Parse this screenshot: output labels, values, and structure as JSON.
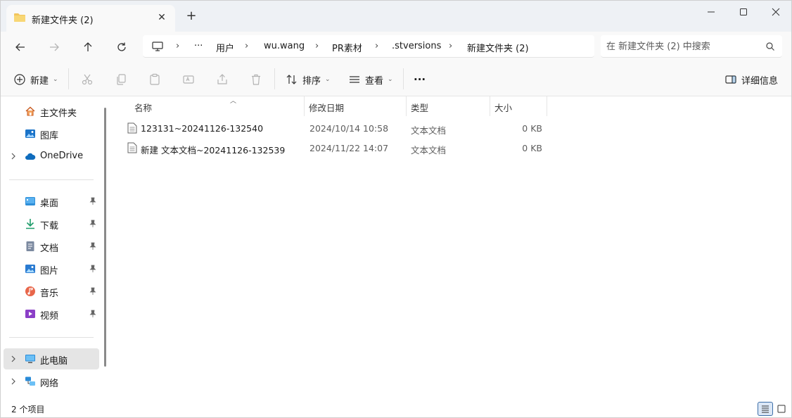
{
  "tab": {
    "title": "新建文件夹 (2)",
    "close_glyph": "✕",
    "new_tab_glyph": "+"
  },
  "window_controls": {
    "minimize": "minimize",
    "maximize": "maximize",
    "close": "close"
  },
  "breadcrumb": {
    "more": "···",
    "items": [
      "用户",
      "wu.wang",
      "PR素材",
      ".stversions",
      "新建文件夹 (2)"
    ],
    "separator": "›"
  },
  "search": {
    "placeholder": "在 新建文件夹 (2) 中搜索"
  },
  "commands": {
    "new": "新建",
    "sort": "排序",
    "view": "查看",
    "more": "···",
    "details": "详细信息"
  },
  "sidebar": {
    "top": [
      {
        "label": "主文件夹",
        "icon": "home-icon"
      },
      {
        "label": "图库",
        "icon": "gallery-icon"
      },
      {
        "label": "OneDrive",
        "icon": "cloud-icon"
      }
    ],
    "quick_access": [
      {
        "label": "桌面",
        "icon": "desktop-icon"
      },
      {
        "label": "下载",
        "icon": "download-icon"
      },
      {
        "label": "文档",
        "icon": "document-icon"
      },
      {
        "label": "图片",
        "icon": "pictures-icon"
      },
      {
        "label": "音乐",
        "icon": "music-icon"
      },
      {
        "label": "视频",
        "icon": "video-icon"
      }
    ],
    "bottom": [
      {
        "label": "此电脑",
        "icon": "computer-icon"
      },
      {
        "label": "网络",
        "icon": "network-icon"
      }
    ]
  },
  "columns": {
    "name": "名称",
    "modified": "修改日期",
    "type": "类型",
    "size": "大小"
  },
  "files": [
    {
      "name": "123131~20241126-132540",
      "modified": "2024/10/14 10:58",
      "type": "文本文档",
      "size": "0 KB"
    },
    {
      "name": "新建 文本文档~20241126-132539",
      "modified": "2024/11/22 14:07",
      "type": "文本文档",
      "size": "0 KB"
    }
  ],
  "status": {
    "item_count": "2 个项目"
  },
  "colors": {
    "accent": "#0067c0",
    "selected_nav": "#e5e5e5",
    "folder": "#f2c55c"
  }
}
